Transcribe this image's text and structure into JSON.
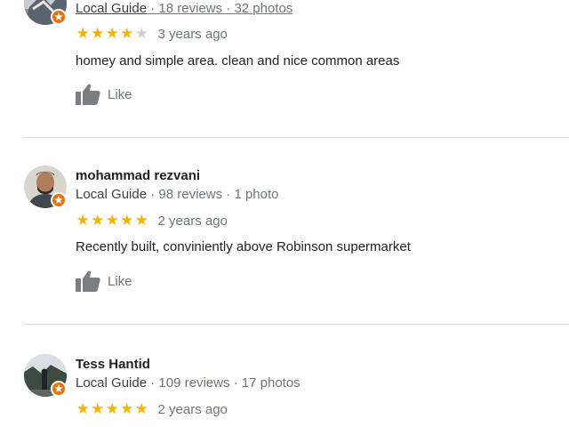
{
  "reviews": [
    {
      "name": "",
      "guide_label": "Local Guide",
      "reviews_count": "18 reviews",
      "photos_count": "32 photos",
      "rating": 4,
      "max_rating": 5,
      "date": "3 years ago",
      "text": "homey and simple area. clean and nice common areas",
      "like_label": "Like"
    },
    {
      "name": "mohammad rezvani",
      "guide_label": "Local Guide",
      "reviews_count": "98 reviews",
      "photos_count": "1 photo",
      "rating": 5,
      "max_rating": 5,
      "date": "2 years ago",
      "text": "Recently built, conviniently above Robinson supermarket",
      "like_label": "Like"
    },
    {
      "name": "Tess Hantid",
      "guide_label": "Local Guide",
      "reviews_count": "109 reviews",
      "photos_count": "17 photos",
      "rating": 5,
      "max_rating": 5,
      "date": "2 years ago",
      "text": "",
      "like_label": ""
    }
  ],
  "separator": " · ",
  "colors": {
    "star_on": "#f4b400",
    "star_off": "#cfcfcf",
    "badge": "#e8710a",
    "muted_text": "#70757a",
    "body_text": "#202124",
    "divider": "#e0e0e0"
  },
  "icons": {
    "like": "thumb-up-icon",
    "badge": "local-guide-star-icon"
  }
}
